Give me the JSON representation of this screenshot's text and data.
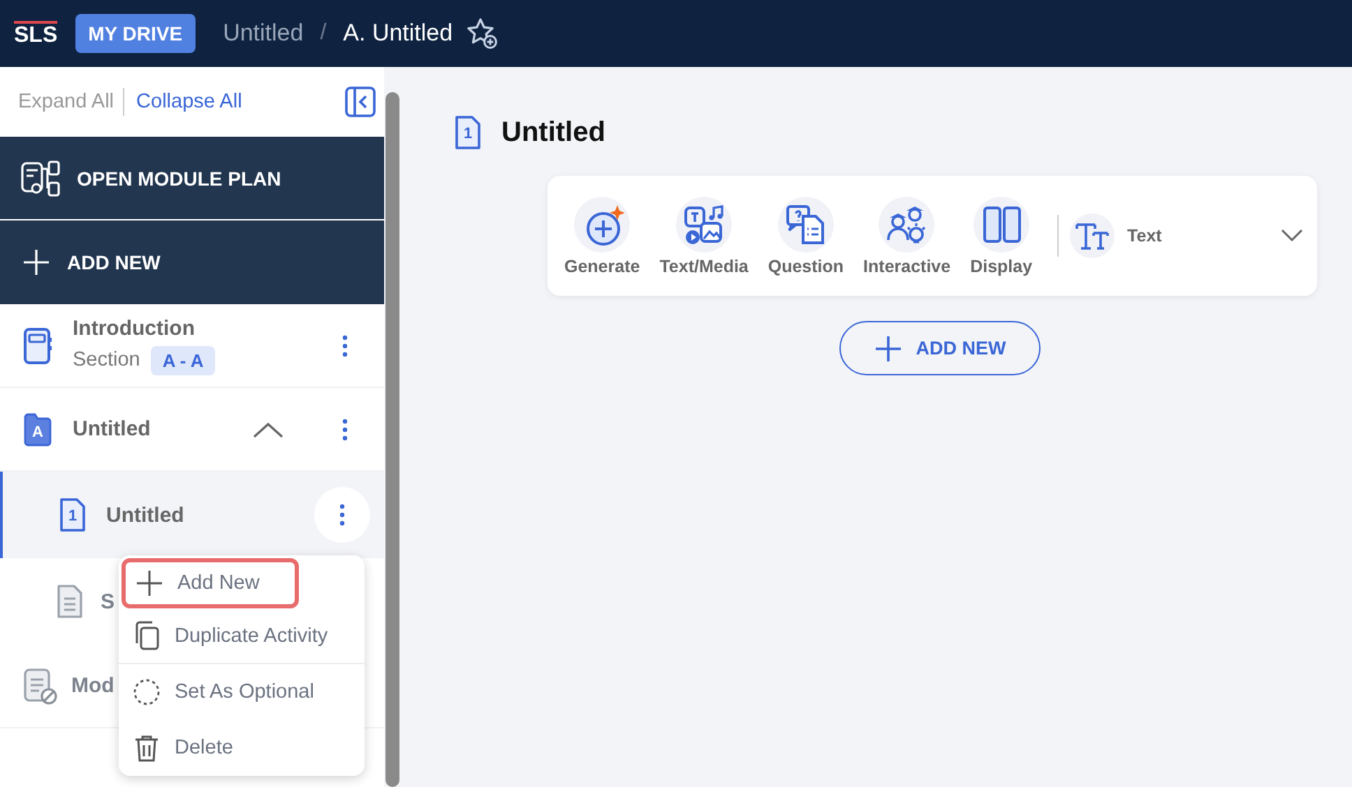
{
  "header": {
    "logo": "SLS",
    "drive_button": "MY DRIVE",
    "breadcrumb": [
      {
        "label": "Untitled",
        "current": false
      },
      {
        "label": "/",
        "kind": "separator"
      },
      {
        "label": "A. Untitled",
        "current": true
      }
    ]
  },
  "sidebar": {
    "expand_all": "Expand All",
    "collapse_all": "Collapse All",
    "open_module_plan": "OPEN MODULE PLAN",
    "add_new": "ADD NEW",
    "items": [
      {
        "kind": "section",
        "title": "Introduction",
        "subtitle": "Section",
        "badge": "A - A"
      },
      {
        "kind": "folder",
        "letter": "A",
        "title": "Untitled",
        "expanded": true,
        "children": [
          {
            "kind": "activity",
            "number": "1",
            "title": "Untitled",
            "selected": true
          },
          {
            "kind": "page",
            "title": "S",
            "selected": false
          }
        ]
      },
      {
        "kind": "module",
        "title": "Mod"
      }
    ]
  },
  "menu": {
    "items": [
      {
        "kind": "add",
        "label": "Add New",
        "highlighted": true
      },
      {
        "kind": "duplicate",
        "label": "Duplicate Activity",
        "highlighted": false
      },
      {
        "kind": "optional",
        "label": "Set As Optional",
        "highlighted": false
      },
      {
        "kind": "delete",
        "label": "Delete",
        "highlighted": false
      }
    ]
  },
  "main": {
    "page_number": "1",
    "title": "Untitled",
    "tools": [
      {
        "kind": "generate",
        "label": "Generate"
      },
      {
        "kind": "media",
        "label": "Text/Media"
      },
      {
        "kind": "question",
        "label": "Question"
      },
      {
        "kind": "interactive",
        "label": "Interactive"
      },
      {
        "kind": "display",
        "label": "Display"
      }
    ],
    "text_style": "Text",
    "add_new": "ADD NEW"
  }
}
